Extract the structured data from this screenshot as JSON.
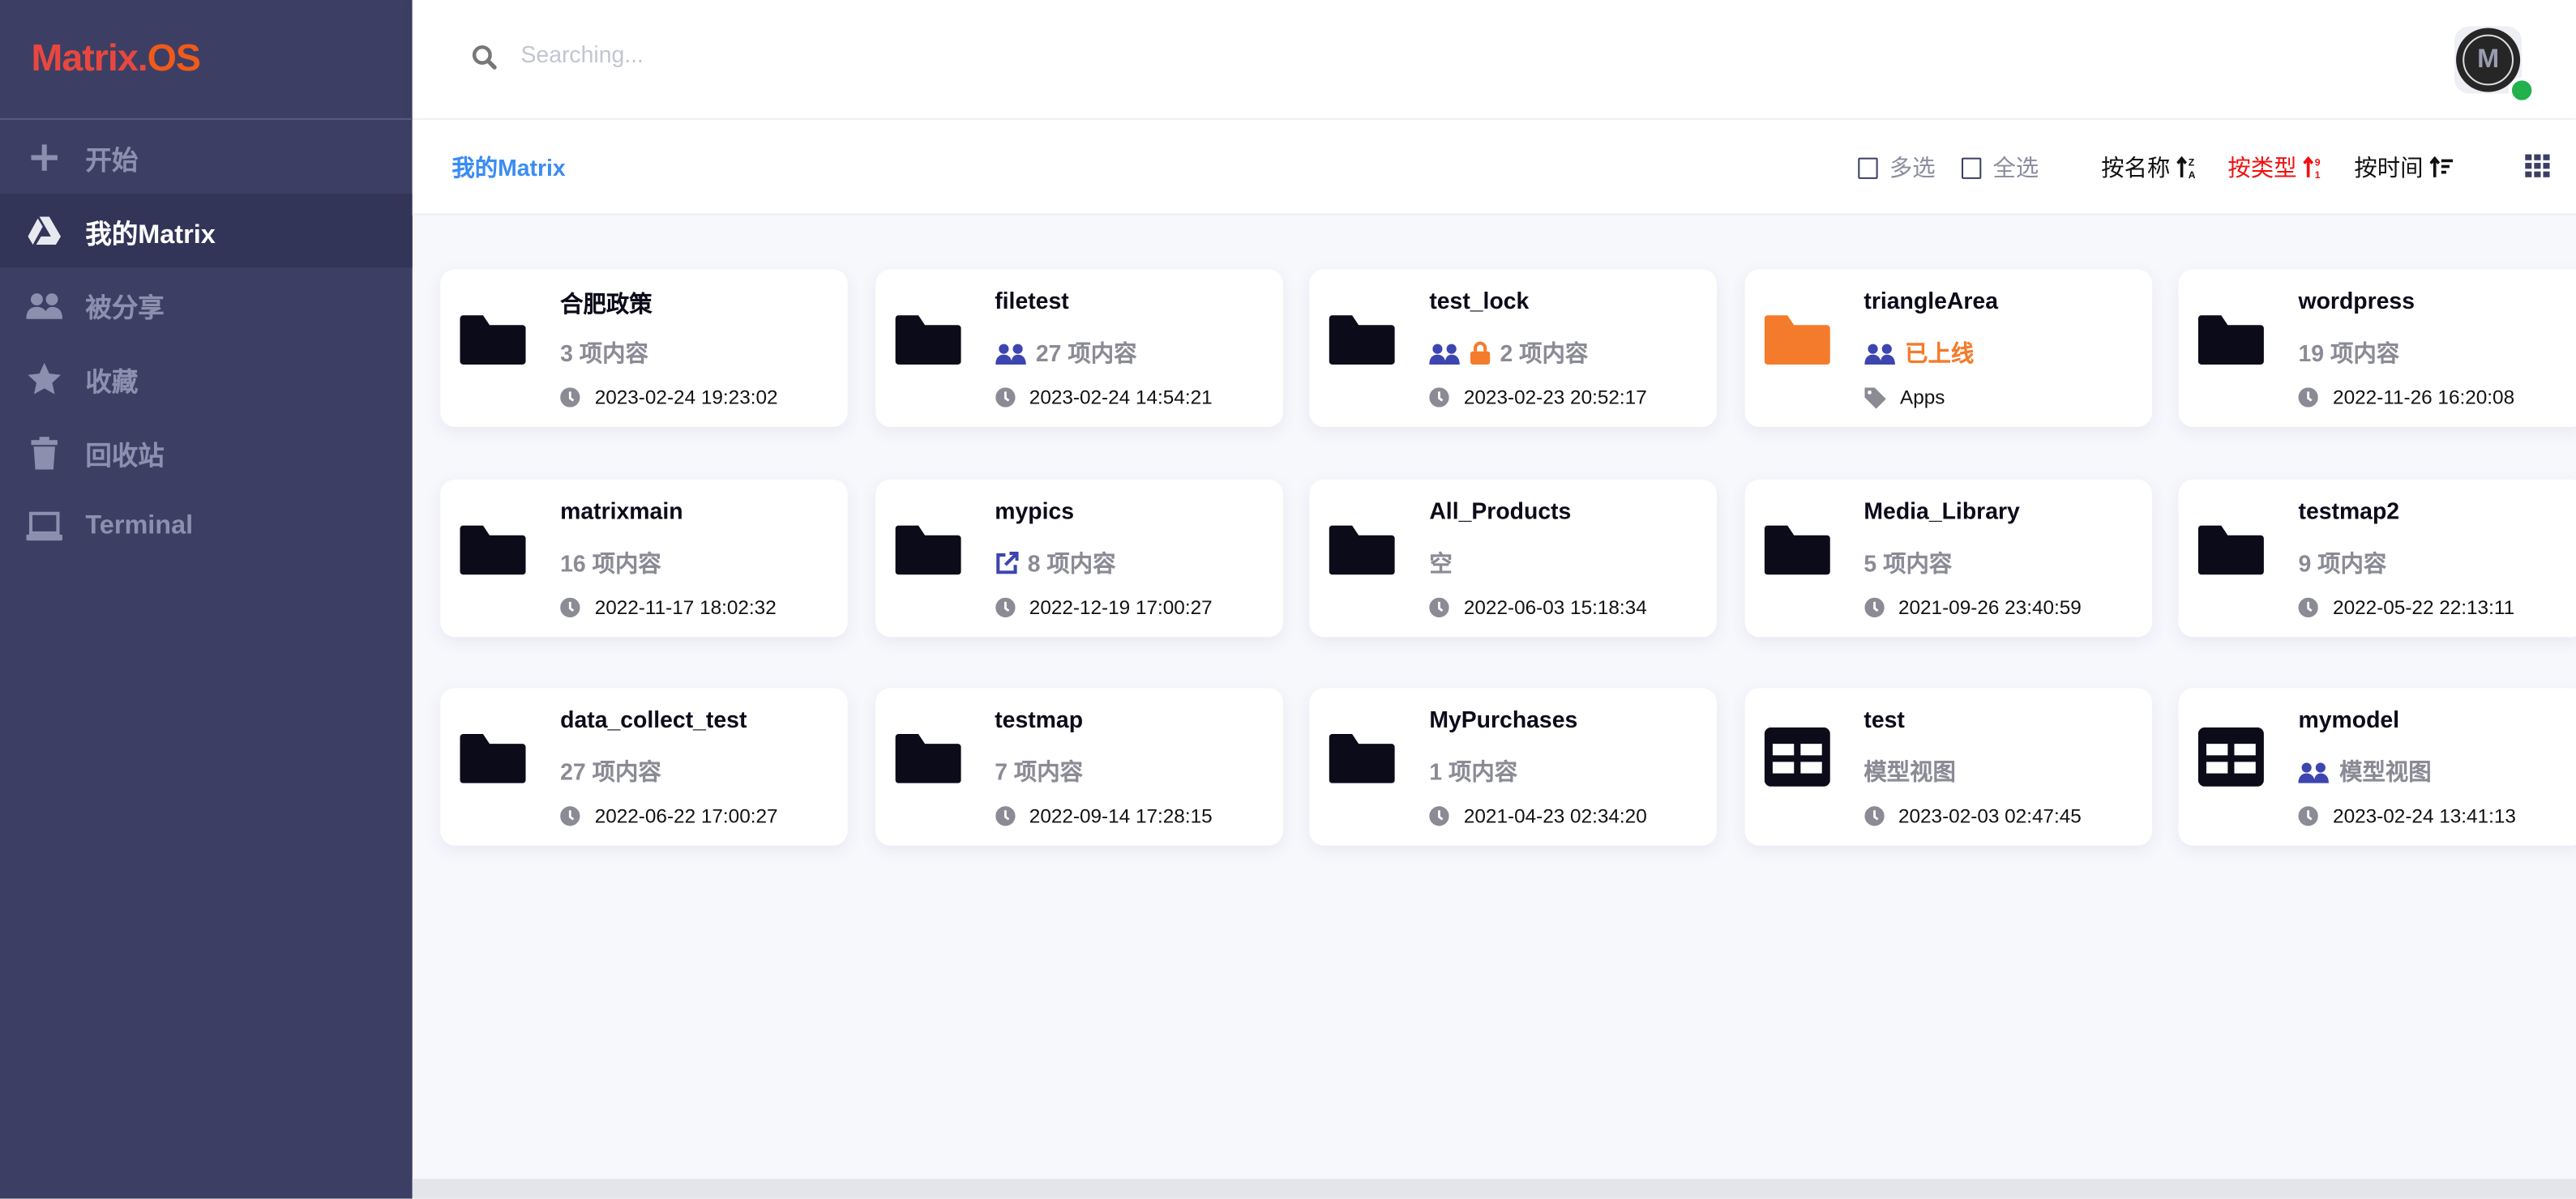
{
  "app": {
    "logo_part1": "Matrix.",
    "logo_part2": "OS"
  },
  "sidebar": {
    "items": [
      {
        "label": "开始",
        "icon": "plus-icon"
      },
      {
        "label": "我的Matrix",
        "icon": "drive-icon",
        "active": true
      },
      {
        "label": "被分享",
        "icon": "users-icon"
      },
      {
        "label": "收藏",
        "icon": "star-icon"
      },
      {
        "label": "回收站",
        "icon": "trash-icon"
      },
      {
        "label": "Terminal",
        "icon": "laptop-icon"
      }
    ]
  },
  "search": {
    "placeholder": "Searching...",
    "value": ""
  },
  "user": {
    "avatar_letter": "M",
    "status": "online",
    "status_color": "#22b14c"
  },
  "toolbar": {
    "breadcrumb": "我的Matrix",
    "multi_select": "多选",
    "select_all": "全选",
    "sort_name": "按名称",
    "sort_type": "按类型",
    "sort_time": "按时间",
    "active_sort": "type",
    "active_color": "#f01010"
  },
  "colors": {
    "sidebar": "#3c3f63",
    "accent": "#3b8cf4",
    "orange": "#f47b2c",
    "shared": "#3d45b0"
  },
  "items": [
    {
      "name": "合肥政策",
      "type": "folder",
      "meta": "3 项内容",
      "badges": [],
      "foot_icon": "clock",
      "foot": "2023-02-24 19:23:02"
    },
    {
      "name": "filetest",
      "type": "folder",
      "meta": "27 项内容",
      "badges": [
        "users"
      ],
      "foot_icon": "clock",
      "foot": "2023-02-24 14:54:21"
    },
    {
      "name": "test_lock",
      "type": "folder",
      "meta": "2 项内容",
      "badges": [
        "users",
        "lock"
      ],
      "foot_icon": "clock",
      "foot": "2023-02-23 20:52:17"
    },
    {
      "name": "triangleArea",
      "type": "folder-orange",
      "meta": "已上线",
      "meta_color": "#f47b2c",
      "badges": [
        "users"
      ],
      "foot_icon": "tag",
      "foot": "Apps"
    },
    {
      "name": "wordpress",
      "type": "folder",
      "meta": "19 项内容",
      "badges": [],
      "foot_icon": "clock",
      "foot": "2022-11-26 16:20:08"
    },
    {
      "name": "matrixmain",
      "type": "folder",
      "meta": "16 项内容",
      "badges": [],
      "foot_icon": "clock",
      "foot": "2022-11-17 18:02:32"
    },
    {
      "name": "mypics",
      "type": "folder",
      "meta": "8 项内容",
      "badges": [
        "external-link"
      ],
      "foot_icon": "clock",
      "foot": "2022-12-19 17:00:27"
    },
    {
      "name": "All_Products",
      "type": "folder",
      "meta": "空",
      "badges": [],
      "foot_icon": "clock",
      "foot": "2022-06-03 15:18:34"
    },
    {
      "name": "Media_Library",
      "type": "folder",
      "meta": "5 项内容",
      "badges": [],
      "foot_icon": "clock",
      "foot": "2021-09-26 23:40:59"
    },
    {
      "name": "testmap2",
      "type": "folder",
      "meta": "9 项内容",
      "badges": [],
      "foot_icon": "clock",
      "foot": "2022-05-22 22:13:11"
    },
    {
      "name": "data_collect_test",
      "type": "folder",
      "meta": "27 项内容",
      "badges": [],
      "foot_icon": "clock",
      "foot": "2022-06-22 17:00:27"
    },
    {
      "name": "testmap",
      "type": "folder",
      "meta": "7 项内容",
      "badges": [],
      "foot_icon": "clock",
      "foot": "2022-09-14 17:28:15"
    },
    {
      "name": "MyPurchases",
      "type": "folder",
      "meta": "1 项内容",
      "badges": [],
      "foot_icon": "clock",
      "foot": "2021-04-23 02:34:20"
    },
    {
      "name": "test",
      "type": "model",
      "meta": "模型视图",
      "badges": [],
      "foot_icon": "clock",
      "foot": "2023-02-03 02:47:45"
    },
    {
      "name": "mymodel",
      "type": "model",
      "meta": "模型视图",
      "badges": [
        "users"
      ],
      "foot_icon": "clock",
      "foot": "2023-02-24 13:41:13"
    }
  ]
}
